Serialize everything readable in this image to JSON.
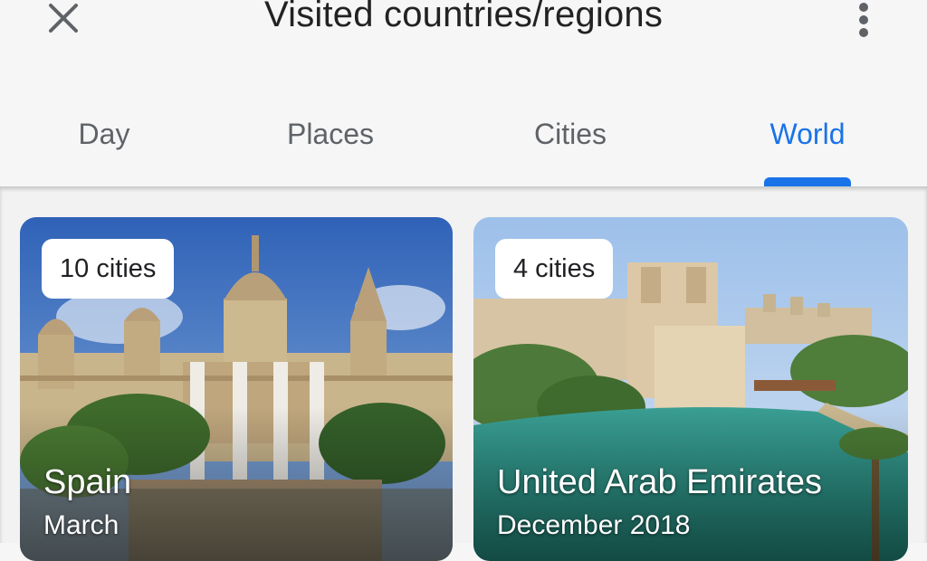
{
  "header": {
    "title": "Visited countries/regions",
    "close_icon": "close-icon",
    "menu_icon": "more-vert-icon"
  },
  "tabs": [
    {
      "label": "Day",
      "active": false
    },
    {
      "label": "Places",
      "active": false
    },
    {
      "label": "Cities",
      "active": false
    },
    {
      "label": "World",
      "active": true
    }
  ],
  "cards": [
    {
      "cities": "10 cities",
      "country": "Spain",
      "date": "March"
    },
    {
      "cities": "4 cities",
      "country": "United Arab Emirates",
      "date": "December 2018"
    }
  ],
  "colors": {
    "accent": "#1a73e8",
    "tab_inactive": "#5f6368"
  }
}
